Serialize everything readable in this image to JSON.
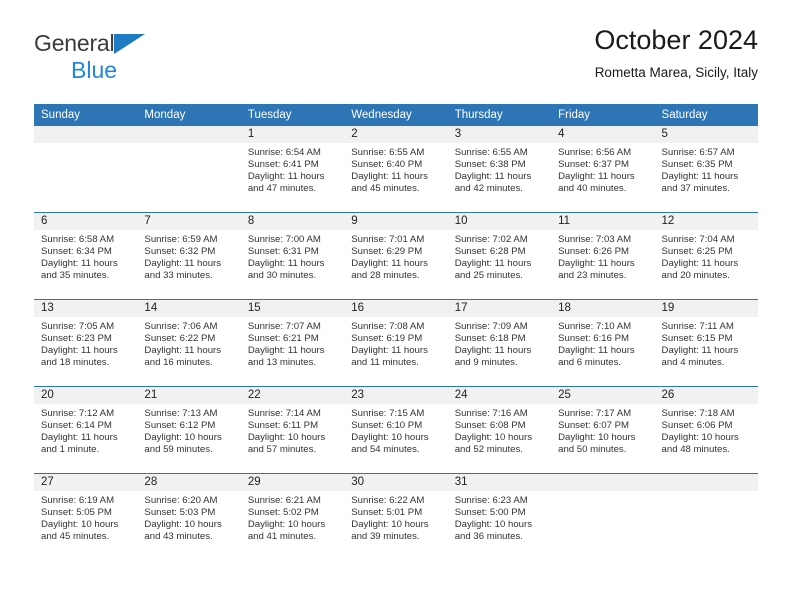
{
  "brand": {
    "line1": "General",
    "line2": "Blue",
    "triangle_color": "#1f7ac4",
    "line2_color": "#1f87dd"
  },
  "header": {
    "title": "October 2024",
    "subtitle": "Rometta Marea, Sicily, Italy"
  },
  "theme": {
    "header_blue": "#2e75b6",
    "daynum_gray": "#f1f1f1",
    "text": "#333333"
  },
  "weekdays": [
    "Sunday",
    "Monday",
    "Tuesday",
    "Wednesday",
    "Thursday",
    "Friday",
    "Saturday"
  ],
  "weeks": [
    [
      {
        "day": "",
        "sunrise": "",
        "sunset": "",
        "daylight": "",
        "daylight2": ""
      },
      {
        "day": "",
        "sunrise": "",
        "sunset": "",
        "daylight": "",
        "daylight2": ""
      },
      {
        "day": "1",
        "sunrise": "Sunrise: 6:54 AM",
        "sunset": "Sunset: 6:41 PM",
        "daylight": "Daylight: 11 hours",
        "daylight2": "and 47 minutes."
      },
      {
        "day": "2",
        "sunrise": "Sunrise: 6:55 AM",
        "sunset": "Sunset: 6:40 PM",
        "daylight": "Daylight: 11 hours",
        "daylight2": "and 45 minutes."
      },
      {
        "day": "3",
        "sunrise": "Sunrise: 6:55 AM",
        "sunset": "Sunset: 6:38 PM",
        "daylight": "Daylight: 11 hours",
        "daylight2": "and 42 minutes."
      },
      {
        "day": "4",
        "sunrise": "Sunrise: 6:56 AM",
        "sunset": "Sunset: 6:37 PM",
        "daylight": "Daylight: 11 hours",
        "daylight2": "and 40 minutes."
      },
      {
        "day": "5",
        "sunrise": "Sunrise: 6:57 AM",
        "sunset": "Sunset: 6:35 PM",
        "daylight": "Daylight: 11 hours",
        "daylight2": "and 37 minutes."
      }
    ],
    [
      {
        "day": "6",
        "sunrise": "Sunrise: 6:58 AM",
        "sunset": "Sunset: 6:34 PM",
        "daylight": "Daylight: 11 hours",
        "daylight2": "and 35 minutes."
      },
      {
        "day": "7",
        "sunrise": "Sunrise: 6:59 AM",
        "sunset": "Sunset: 6:32 PM",
        "daylight": "Daylight: 11 hours",
        "daylight2": "and 33 minutes."
      },
      {
        "day": "8",
        "sunrise": "Sunrise: 7:00 AM",
        "sunset": "Sunset: 6:31 PM",
        "daylight": "Daylight: 11 hours",
        "daylight2": "and 30 minutes."
      },
      {
        "day": "9",
        "sunrise": "Sunrise: 7:01 AM",
        "sunset": "Sunset: 6:29 PM",
        "daylight": "Daylight: 11 hours",
        "daylight2": "and 28 minutes."
      },
      {
        "day": "10",
        "sunrise": "Sunrise: 7:02 AM",
        "sunset": "Sunset: 6:28 PM",
        "daylight": "Daylight: 11 hours",
        "daylight2": "and 25 minutes."
      },
      {
        "day": "11",
        "sunrise": "Sunrise: 7:03 AM",
        "sunset": "Sunset: 6:26 PM",
        "daylight": "Daylight: 11 hours",
        "daylight2": "and 23 minutes."
      },
      {
        "day": "12",
        "sunrise": "Sunrise: 7:04 AM",
        "sunset": "Sunset: 6:25 PM",
        "daylight": "Daylight: 11 hours",
        "daylight2": "and 20 minutes."
      }
    ],
    [
      {
        "day": "13",
        "sunrise": "Sunrise: 7:05 AM",
        "sunset": "Sunset: 6:23 PM",
        "daylight": "Daylight: 11 hours",
        "daylight2": "and 18 minutes."
      },
      {
        "day": "14",
        "sunrise": "Sunrise: 7:06 AM",
        "sunset": "Sunset: 6:22 PM",
        "daylight": "Daylight: 11 hours",
        "daylight2": "and 16 minutes."
      },
      {
        "day": "15",
        "sunrise": "Sunrise: 7:07 AM",
        "sunset": "Sunset: 6:21 PM",
        "daylight": "Daylight: 11 hours",
        "daylight2": "and 13 minutes."
      },
      {
        "day": "16",
        "sunrise": "Sunrise: 7:08 AM",
        "sunset": "Sunset: 6:19 PM",
        "daylight": "Daylight: 11 hours",
        "daylight2": "and 11 minutes."
      },
      {
        "day": "17",
        "sunrise": "Sunrise: 7:09 AM",
        "sunset": "Sunset: 6:18 PM",
        "daylight": "Daylight: 11 hours",
        "daylight2": "and 9 minutes."
      },
      {
        "day": "18",
        "sunrise": "Sunrise: 7:10 AM",
        "sunset": "Sunset: 6:16 PM",
        "daylight": "Daylight: 11 hours",
        "daylight2": "and 6 minutes."
      },
      {
        "day": "19",
        "sunrise": "Sunrise: 7:11 AM",
        "sunset": "Sunset: 6:15 PM",
        "daylight": "Daylight: 11 hours",
        "daylight2": "and 4 minutes."
      }
    ],
    [
      {
        "day": "20",
        "sunrise": "Sunrise: 7:12 AM",
        "sunset": "Sunset: 6:14 PM",
        "daylight": "Daylight: 11 hours",
        "daylight2": "and 1 minute."
      },
      {
        "day": "21",
        "sunrise": "Sunrise: 7:13 AM",
        "sunset": "Sunset: 6:12 PM",
        "daylight": "Daylight: 10 hours",
        "daylight2": "and 59 minutes."
      },
      {
        "day": "22",
        "sunrise": "Sunrise: 7:14 AM",
        "sunset": "Sunset: 6:11 PM",
        "daylight": "Daylight: 10 hours",
        "daylight2": "and 57 minutes."
      },
      {
        "day": "23",
        "sunrise": "Sunrise: 7:15 AM",
        "sunset": "Sunset: 6:10 PM",
        "daylight": "Daylight: 10 hours",
        "daylight2": "and 54 minutes."
      },
      {
        "day": "24",
        "sunrise": "Sunrise: 7:16 AM",
        "sunset": "Sunset: 6:08 PM",
        "daylight": "Daylight: 10 hours",
        "daylight2": "and 52 minutes."
      },
      {
        "day": "25",
        "sunrise": "Sunrise: 7:17 AM",
        "sunset": "Sunset: 6:07 PM",
        "daylight": "Daylight: 10 hours",
        "daylight2": "and 50 minutes."
      },
      {
        "day": "26",
        "sunrise": "Sunrise: 7:18 AM",
        "sunset": "Sunset: 6:06 PM",
        "daylight": "Daylight: 10 hours",
        "daylight2": "and 48 minutes."
      }
    ],
    [
      {
        "day": "27",
        "sunrise": "Sunrise: 6:19 AM",
        "sunset": "Sunset: 5:05 PM",
        "daylight": "Daylight: 10 hours",
        "daylight2": "and 45 minutes."
      },
      {
        "day": "28",
        "sunrise": "Sunrise: 6:20 AM",
        "sunset": "Sunset: 5:03 PM",
        "daylight": "Daylight: 10 hours",
        "daylight2": "and 43 minutes."
      },
      {
        "day": "29",
        "sunrise": "Sunrise: 6:21 AM",
        "sunset": "Sunset: 5:02 PM",
        "daylight": "Daylight: 10 hours",
        "daylight2": "and 41 minutes."
      },
      {
        "day": "30",
        "sunrise": "Sunrise: 6:22 AM",
        "sunset": "Sunset: 5:01 PM",
        "daylight": "Daylight: 10 hours",
        "daylight2": "and 39 minutes."
      },
      {
        "day": "31",
        "sunrise": "Sunrise: 6:23 AM",
        "sunset": "Sunset: 5:00 PM",
        "daylight": "Daylight: 10 hours",
        "daylight2": "and 36 minutes."
      },
      {
        "day": "",
        "sunrise": "",
        "sunset": "",
        "daylight": "",
        "daylight2": ""
      },
      {
        "day": "",
        "sunrise": "",
        "sunset": "",
        "daylight": "",
        "daylight2": ""
      }
    ]
  ]
}
